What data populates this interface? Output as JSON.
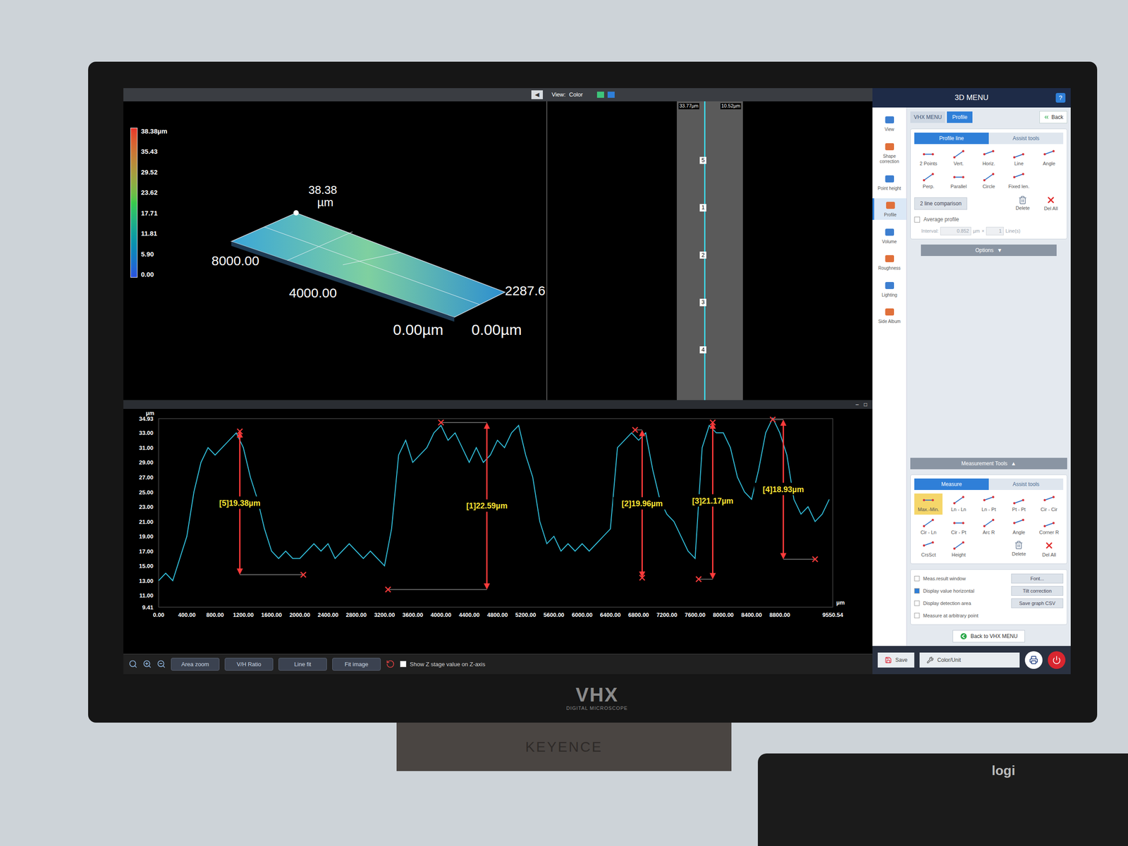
{
  "monitor": {
    "brand": "VHX",
    "subtitle": "DIGITAL MICROSCOPE",
    "maker": "KEYENCE"
  },
  "keyboard": {
    "brand": "logi"
  },
  "view_header": {
    "collapse": "◀",
    "view_label": "View:",
    "view_value": "Color"
  },
  "legend": {
    "max": "38.38µm",
    "ticks": [
      "35.43",
      "29.52",
      "23.62",
      "17.71",
      "11.81",
      "5.90",
      "0.00"
    ]
  },
  "plot3d": {
    "peak": "38.38",
    "peak_unit": "µm",
    "y_far": "8000.00",
    "y_mid": "4000.00",
    "x_end": "2287.6",
    "origin_x": "0.00µm",
    "origin_y": "0.00µm"
  },
  "image_strip": {
    "labels": [
      "33.77µm",
      "10.52µm"
    ],
    "markers": [
      "5",
      "1",
      "2",
      "3",
      "4"
    ]
  },
  "profile": {
    "window_buttons": [
      "–",
      "□"
    ],
    "unit": "µm",
    "y_min": 9.41,
    "y_max": 34.93,
    "y_ticks": [
      "34.93",
      "33.00",
      "31.00",
      "29.00",
      "27.00",
      "25.00",
      "23.00",
      "21.00",
      "19.00",
      "17.00",
      "15.00",
      "13.00",
      "11.00",
      "9.41"
    ],
    "x_ticks": [
      "0.00",
      "400.00",
      "800.00",
      "1200.00",
      "1600.00",
      "2000.00",
      "2400.00",
      "2800.00",
      "3200.00",
      "3600.00",
      "4000.00",
      "4400.00",
      "4800.00",
      "5200.00",
      "5600.00",
      "6000.00",
      "6400.00",
      "6800.00",
      "7200.00",
      "7600.00",
      "8000.00",
      "8400.00",
      "8800.00",
      "9550.54"
    ],
    "x_max": 9550.54,
    "x_step": 100,
    "values": [
      13,
      14,
      13,
      16,
      19,
      25,
      29,
      31,
      30,
      31,
      32,
      33,
      31,
      27,
      24,
      20,
      17,
      16,
      17,
      16,
      16,
      17,
      18,
      17,
      18,
      16,
      17,
      18,
      17,
      16,
      17,
      16,
      15,
      20,
      30,
      32,
      29,
      30,
      31,
      33,
      34,
      32,
      33,
      31,
      29,
      31,
      29,
      30,
      32,
      31,
      33,
      34,
      30,
      27,
      21,
      18,
      19,
      17,
      18,
      17,
      18,
      17,
      18,
      19,
      20,
      31,
      32,
      33,
      32,
      33,
      28,
      24,
      22,
      21,
      19,
      17,
      16,
      31,
      34,
      33,
      33,
      31,
      27,
      25,
      24,
      28,
      33,
      35,
      33,
      30,
      24,
      22,
      23,
      21,
      22,
      24
    ],
    "measurements": [
      {
        "label": "[5]19.38µm",
        "x": 1150,
        "top": 33.2,
        "bottom": 13.8,
        "top_marker_x": 1150,
        "bottom_marker_x": 2050
      },
      {
        "label": "[1]22.59µm",
        "x": 4650,
        "top": 34.4,
        "bottom": 11.8,
        "top_marker_x": 4000,
        "bottom_marker_x": 3250
      },
      {
        "label": "[2]19.96µm",
        "x": 6850,
        "top": 33.4,
        "bottom": 13.4,
        "top_marker_x": 6750,
        "bottom_marker_x": 6850
      },
      {
        "label": "[3]21.17µm",
        "x": 7850,
        "top": 34.4,
        "bottom": 13.2,
        "top_marker_x": 7850,
        "bottom_marker_x": 7650
      },
      {
        "label": "[4]18.93µm",
        "x": 8850,
        "top": 34.8,
        "bottom": 15.9,
        "top_marker_x": 8700,
        "bottom_marker_x": 9300
      }
    ]
  },
  "chart_toolbar": {
    "buttons": [
      "Area zoom",
      "V/H Ratio",
      "Line fit",
      "Fit image"
    ],
    "checkbox": {
      "label": "Show Z stage value on Z-axis",
      "checked": false
    }
  },
  "menu": {
    "title": "3D MENU",
    "help": "?",
    "breadcrumb": [
      "VHX MENU",
      "Profile"
    ],
    "back": "Back",
    "sidebar": [
      {
        "label": "View",
        "selected": false
      },
      {
        "label": "Shape correction",
        "selected": false
      },
      {
        "label": "Point height",
        "selected": false
      },
      {
        "label": "Profile",
        "selected": true
      },
      {
        "label": "Volume",
        "selected": false
      },
      {
        "label": "Roughness",
        "selected": false
      },
      {
        "label": "Lighting",
        "selected": false
      },
      {
        "label": "Side Album",
        "selected": false
      }
    ],
    "profile_tabs": [
      {
        "label": "Profile line",
        "selected": true
      },
      {
        "label": "Assist tools",
        "selected": false
      }
    ],
    "profile_tools": [
      {
        "label": "2 Points",
        "selected": false
      },
      {
        "label": "Vert.",
        "selected": false
      },
      {
        "label": "Horiz.",
        "selected": false
      },
      {
        "label": "Line",
        "selected": false
      },
      {
        "label": "Angle",
        "selected": false
      },
      {
        "label": "Perp.",
        "selected": false
      },
      {
        "label": "Parallel",
        "selected": false
      },
      {
        "label": "Circle",
        "selected": false
      },
      {
        "label": "Fixed len.",
        "selected": false
      }
    ],
    "comparison": "2 line comparison",
    "profile_actions": [
      {
        "label": "Delete",
        "kind": "delete"
      },
      {
        "label": "Del All",
        "kind": "delete-all"
      }
    ],
    "average": {
      "label": "Average profile",
      "checked": false,
      "interval_label": "Interval:",
      "interval": "0.852",
      "unit": "µm",
      "times": "×",
      "lines": "1",
      "lines_unit": "Line(s)",
      "disabled": true
    },
    "options": "Options",
    "options_arrow": "▼",
    "measurement_title": "Measurement Tools",
    "measurement_arrow": "▲",
    "measure_tabs": [
      {
        "label": "Measure",
        "selected": true
      },
      {
        "label": "Assist tools",
        "selected": false
      }
    ],
    "measure_tools": [
      {
        "label": "Max.-Min.",
        "kind": "tool",
        "selected": true
      },
      {
        "label": "Ln - Ln",
        "kind": "tool",
        "selected": false
      },
      {
        "label": "Ln - Pt",
        "kind": "tool",
        "selected": false
      },
      {
        "label": "Pt - Pt",
        "kind": "tool",
        "selected": false
      },
      {
        "label": "Cir - Cir",
        "kind": "tool",
        "selected": false
      },
      {
        "label": "Cir - Ln",
        "kind": "tool",
        "selected": false
      },
      {
        "label": "Cir - Pt",
        "kind": "tool",
        "selected": false
      },
      {
        "label": "Arc R",
        "kind": "tool",
        "selected": false
      },
      {
        "label": "Angle",
        "kind": "tool",
        "selected": false
      },
      {
        "label": "Corner R",
        "kind": "tool",
        "selected": false
      },
      {
        "label": "CrsSct",
        "kind": "tool",
        "selected": false
      },
      {
        "label": "Height",
        "kind": "tool",
        "selected": false
      },
      {
        "label": "Delete",
        "kind": "delete",
        "selected": false
      },
      {
        "label": "Del All",
        "kind": "delete-all",
        "selected": false
      }
    ],
    "checks": [
      {
        "label": "Meas.result window",
        "checked": false,
        "button": "Font..."
      },
      {
        "label": "Display value horizontal",
        "checked": true,
        "button": "Tilt correction"
      },
      {
        "label": "Display detection area",
        "checked": false,
        "button": "Save graph CSV"
      },
      {
        "label": "Measure at arbitrary point",
        "checked": false,
        "button": ""
      }
    ],
    "back_menu": "Back to VHX MENU",
    "footer": {
      "save": "Save",
      "color_unit": "Color/Unit"
    }
  }
}
